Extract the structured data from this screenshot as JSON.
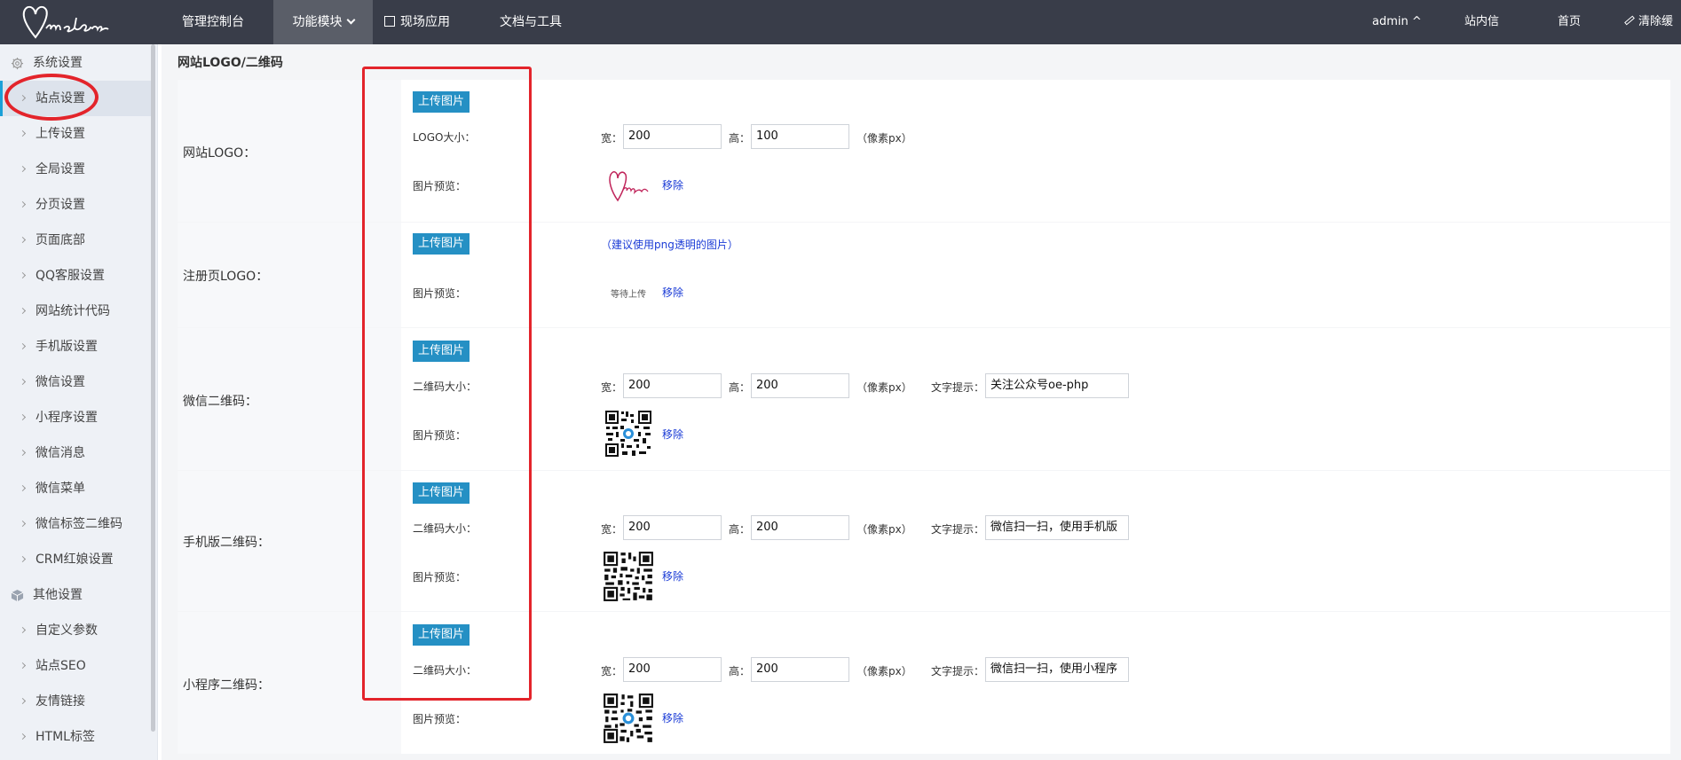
{
  "header": {
    "logo_text": "Melone",
    "nav": [
      "管理控制台",
      "功能模块",
      "现场应用",
      "文档与工具"
    ],
    "user": "admin ^",
    "right": [
      "站内信",
      "首页",
      "清除缓存"
    ]
  },
  "sidebar": {
    "group1": "系统设置",
    "items1": [
      "站点设置",
      "上传设置",
      "全局设置",
      "分页设置",
      "页面底部",
      "QQ客服设置",
      "网站统计代码",
      "手机版设置",
      "微信设置",
      "小程序设置",
      "微信消息",
      "微信菜单",
      "微信标签二维码",
      "CRM红娘设置"
    ],
    "group2": "其他设置",
    "items2": [
      "自定义参数",
      "站点SEO",
      "友情链接",
      "HTML标签"
    ]
  },
  "main": {
    "section_title": "网站LOGO/二维码",
    "upload_button": "上传图片",
    "remove_link": "移除",
    "preview_label": "图片预览：",
    "width_label": "宽：",
    "height_label": "高：",
    "unit_text": "（像素px）",
    "text_tip_label": "文字提示：",
    "rows": [
      {
        "label": "网站LOGO：",
        "size_label": "LOGO大小：",
        "w": "200",
        "h": "100"
      },
      {
        "label": "注册页LOGO：",
        "hint": "（建议使用png透明的图片）",
        "pending": "等待上传"
      },
      {
        "label": "微信二维码：",
        "size_label": "二维码大小：",
        "w": "200",
        "h": "200",
        "tip": "关注公众号oe-php"
      },
      {
        "label": "手机版二维码：",
        "size_label": "二维码大小：",
        "w": "200",
        "h": "200",
        "tip": "微信扫一扫，使用手机版"
      },
      {
        "label": "小程序二维码：",
        "size_label": "二维码大小：",
        "w": "200",
        "h": "200",
        "tip": "微信扫一扫，使用小程序"
      }
    ]
  },
  "colors": {
    "topbar": "#393d49",
    "upload_button": "#2590c4",
    "annotation": "#e3242b",
    "link": "#1a3bd6"
  }
}
